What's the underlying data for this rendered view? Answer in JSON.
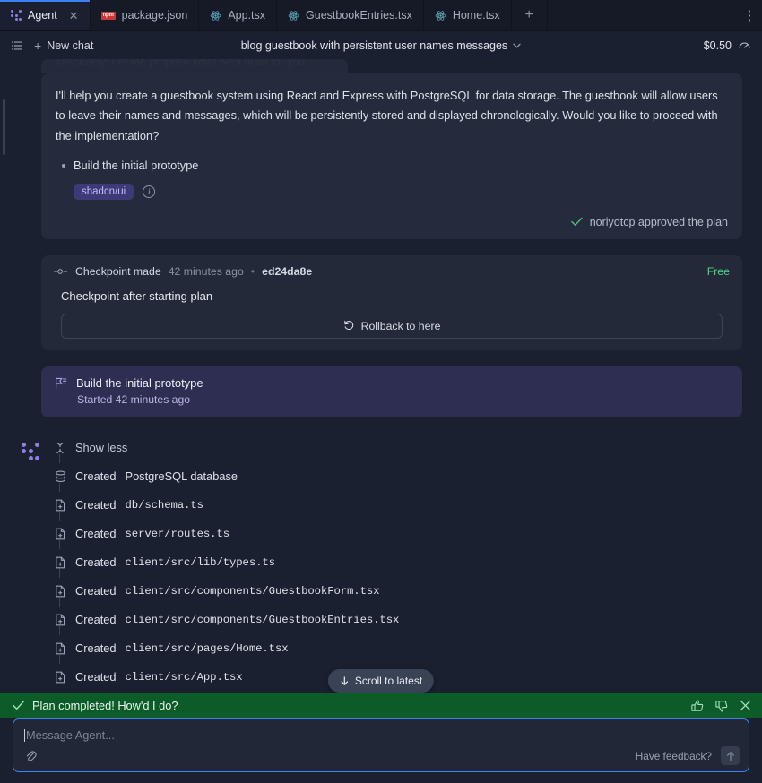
{
  "tabs": [
    {
      "label": "Agent",
      "icon": "agent-dots-icon",
      "active": true,
      "closable": true
    },
    {
      "label": "package.json",
      "icon": "npm-icon",
      "active": false,
      "closable": false
    },
    {
      "label": "App.tsx",
      "icon": "react-icon",
      "active": false,
      "closable": false
    },
    {
      "label": "GuestbookEntries.tsx",
      "icon": "react-icon",
      "active": false,
      "closable": false
    },
    {
      "label": "Home.tsx",
      "icon": "react-icon",
      "active": false,
      "closable": false
    }
  ],
  "tabbar": {
    "add_tab_label": "+",
    "overflow_label": "⋮"
  },
  "header": {
    "menu_icon": "list-icon",
    "new_chat_label": "New chat",
    "new_chat_plus": "+",
    "title": "blog guestbook with persistent user names messages",
    "title_chevron": "⌄",
    "cost": "$0.50",
    "usage_icon": "gauge-icon"
  },
  "faded_message": {
    "text": "Absolutely! Let me propose what we'll build for you."
  },
  "assistant_card": {
    "body": "I'll help you create a guestbook system using React and Express with PostgreSQL for data storage. The guestbook will allow users to leave their names and messages, which will be persistently stored and displayed chronologically. Would you like to proceed with the implementation?",
    "bullets": [
      "Build the initial prototype"
    ],
    "tags": [
      "shadcn/ui"
    ],
    "info_icon": "info-icon",
    "approval": {
      "check_icon": "check-icon",
      "text": "noriyotcp approved the plan"
    }
  },
  "checkpoint": {
    "icon": "checkpoint-node-icon",
    "label": "Checkpoint made",
    "time": "42 minutes ago",
    "separator": "•",
    "hash": "ed24da8e",
    "badge": "Free",
    "title": "Checkpoint after starting plan",
    "rollback_label": "Rollback to here",
    "rollback_icon": "undo-icon"
  },
  "task": {
    "icon": "flag-icon",
    "title": "Build the initial prototype",
    "subtitle": "Started 42 minutes ago"
  },
  "activity": {
    "logo_icon": "agent-dots-icon",
    "toggle_label": "Show less",
    "toggle_icon": "collapse-icon",
    "items": [
      {
        "verb": "Created",
        "target": "PostgreSQL database",
        "icon": "database-icon",
        "mono": false
      },
      {
        "verb": "Created",
        "target": "db/schema.ts",
        "icon": "file-add-icon",
        "mono": true
      },
      {
        "verb": "Created",
        "target": "server/routes.ts",
        "icon": "file-add-icon",
        "mono": true
      },
      {
        "verb": "Created",
        "target": "client/src/lib/types.ts",
        "icon": "file-add-icon",
        "mono": true
      },
      {
        "verb": "Created",
        "target": "client/src/components/GuestbookForm.tsx",
        "icon": "file-add-icon",
        "mono": true
      },
      {
        "verb": "Created",
        "target": "client/src/components/GuestbookEntries.tsx",
        "icon": "file-add-icon",
        "mono": true
      },
      {
        "verb": "Created",
        "target": "client/src/pages/Home.tsx",
        "icon": "file-add-icon",
        "mono": true
      },
      {
        "verb": "Created",
        "target": "client/src/App.tsx",
        "icon": "file-add-icon",
        "mono": true
      }
    ]
  },
  "scroll_pill": {
    "label": "Scroll to latest",
    "icon": "arrow-down-icon"
  },
  "toast": {
    "check_icon": "check-icon",
    "message": "Plan completed! How'd I do?",
    "thumbs_up_icon": "thumbs-up-icon",
    "thumbs_down_icon": "thumbs-down-icon",
    "close_icon": "close-icon",
    "background": "#0d5b28"
  },
  "composer": {
    "placeholder": "Message Agent...",
    "value": "",
    "attach_icon": "paperclip-icon",
    "feedback_label": "Have feedback?",
    "send_icon": "arrow-up-icon",
    "focus_color": "#3b82f6"
  }
}
